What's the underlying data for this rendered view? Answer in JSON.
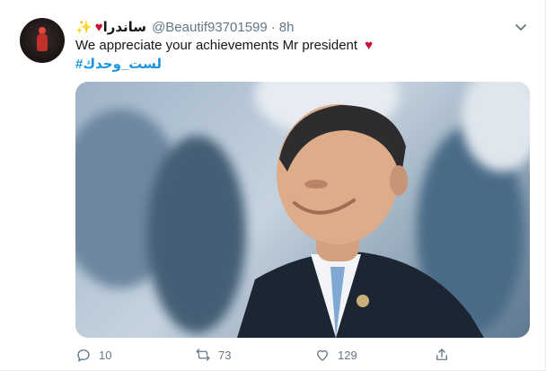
{
  "tweet": {
    "display_name": "ساندرا",
    "handle": "@Beautif93701599",
    "separator": "·",
    "time": "8h",
    "text": "We appreciate your achievements Mr president",
    "hashtag": "#لست_وحدك",
    "image_description": "photo of a smiling man in a dark suit and light blue tie, crowd blurred in background"
  },
  "actions": {
    "reply_count": "10",
    "retweet_count": "73",
    "like_count": "129"
  },
  "colors": {
    "accent": "#1b95e0",
    "muted": "#657786",
    "text": "#14171a",
    "heart": "#c8102e"
  },
  "icons": {
    "reply": "reply-icon",
    "retweet": "retweet-icon",
    "like": "like-icon",
    "share": "share-icon",
    "caret": "chevron-down-icon"
  }
}
